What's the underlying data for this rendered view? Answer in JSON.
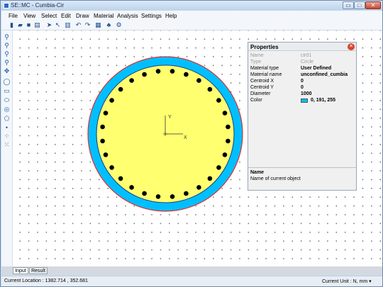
{
  "window": {
    "title": "SE::MC - Cumbia-Cir",
    "minimize_label": "▭",
    "maximize_label": "□",
    "close_label": "✕"
  },
  "menu": [
    "File",
    "View",
    "Select",
    "Edit",
    "Draw",
    "Material",
    "Analysis",
    "Settings",
    "Help"
  ],
  "toolbar_icons": [
    "new-icon",
    "open-icon",
    "save-icon",
    "print-icon",
    "select-arrow-icon",
    "select-region-icon",
    "delete-icon",
    "undo-icon",
    "redo-icon",
    "calculator-icon",
    "tree-icon",
    "settings-icon"
  ],
  "tool_palette_icons": [
    "zoom-in-icon",
    "zoom-out-icon",
    "zoom-window-icon",
    "zoom-fit-icon",
    "pan-icon",
    "circle-icon",
    "rectangle-icon",
    "ellipse-icon",
    "ring-icon",
    "polygon-icon",
    "point-icon",
    "circle-points-icon",
    "rect-points-icon"
  ],
  "canvas": {
    "axis_y_label": "Y",
    "axis_x_label": "X",
    "colors": {
      "outer_ring": "#00bfff",
      "core": "#ffff70",
      "outline": "#e03030",
      "rebar": "#000000"
    },
    "rebar_count": 28
  },
  "properties": {
    "title": "Properties",
    "close_label": "✕",
    "rows": [
      {
        "key": "Name",
        "value": "cir01",
        "disabled": true
      },
      {
        "key": "Type",
        "value": "Circle",
        "disabled": true
      },
      {
        "key": "Material type",
        "value": "User Defined",
        "disabled": false
      },
      {
        "key": "Material name",
        "value": "unconfined_cumbia",
        "disabled": false
      },
      {
        "key": "Centroid  X",
        "value": "0",
        "disabled": false
      },
      {
        "key": "Centroid  Y",
        "value": "0",
        "disabled": false
      },
      {
        "key": "Diameter",
        "value": "1000",
        "disabled": false
      }
    ],
    "color_row": {
      "key": "Color",
      "value": "0, 191, 255",
      "swatch": "#00bfff"
    },
    "description_title": "Name",
    "description_text": "Name of current object"
  },
  "tabs": [
    {
      "label": "Input",
      "active": true
    },
    {
      "label": "Result",
      "active": false
    }
  ],
  "status": {
    "location": "Current Location :  1382.714 , 352.681",
    "unit": "Current Unit :    N, mm  ▾"
  }
}
